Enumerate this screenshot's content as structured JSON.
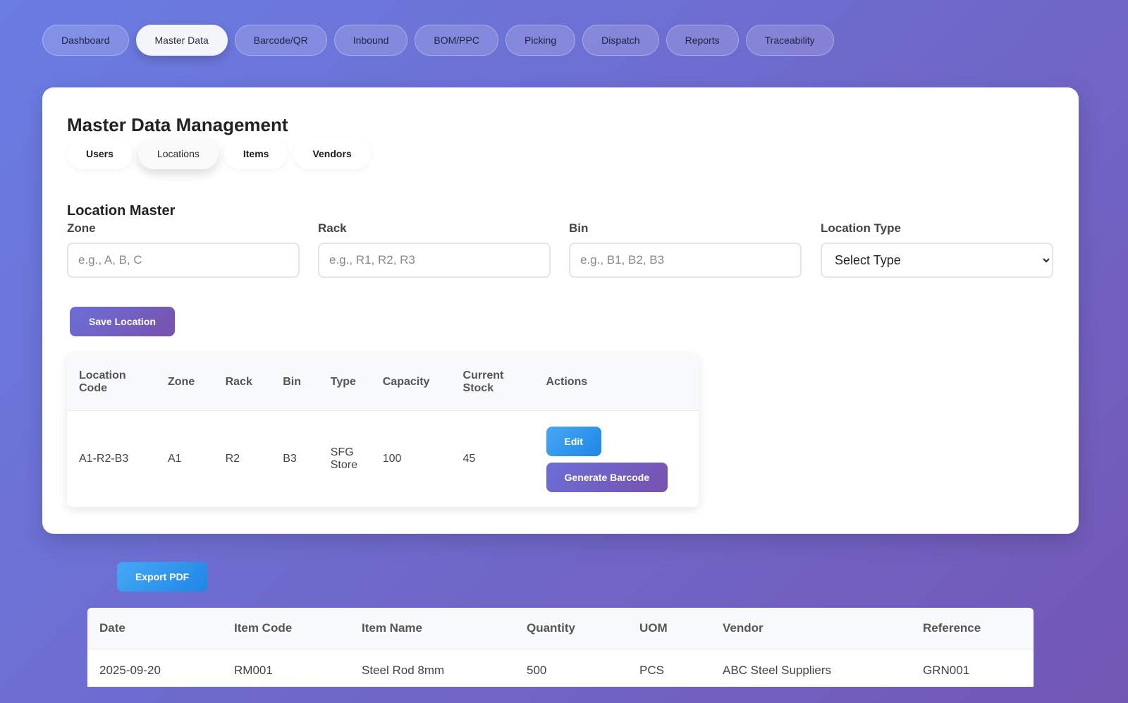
{
  "nav": {
    "tabs": [
      {
        "label": "Dashboard",
        "active": false
      },
      {
        "label": "Master Data",
        "active": true
      },
      {
        "label": "Barcode/QR",
        "active": false
      },
      {
        "label": "Inbound",
        "active": false
      },
      {
        "label": "BOM/PPC",
        "active": false
      },
      {
        "label": "Picking",
        "active": false
      },
      {
        "label": "Dispatch",
        "active": false
      },
      {
        "label": "Reports",
        "active": false
      },
      {
        "label": "Traceability",
        "active": false
      }
    ]
  },
  "master": {
    "title": "Master Data Management",
    "subtabs": [
      {
        "label": "Users",
        "active": false
      },
      {
        "label": "Locations",
        "active": true
      },
      {
        "label": "Items",
        "active": false
      },
      {
        "label": "Vendors",
        "active": false
      }
    ],
    "section_title": "Location Master",
    "form": {
      "zone_label": "Zone",
      "zone_placeholder": "e.g., A, B, C",
      "rack_label": "Rack",
      "rack_placeholder": "e.g., R1, R2, R3",
      "bin_label": "Bin",
      "bin_placeholder": "e.g., B1, B2, B3",
      "type_label": "Location Type",
      "type_selected": "Select Type",
      "save_label": "Save Location"
    },
    "table": {
      "headers": [
        "Location Code",
        "Zone",
        "Rack",
        "Bin",
        "Type",
        "Capacity",
        "Current Stock",
        "Actions"
      ],
      "rows": [
        {
          "code": "A1-R2-B3",
          "zone": "A1",
          "rack": "R2",
          "bin": "B3",
          "type": "SFG Store",
          "capacity": "100",
          "stock": "45"
        }
      ],
      "edit_label": "Edit",
      "barcode_label": "Generate Barcode"
    }
  },
  "report": {
    "export_label": "Export PDF",
    "headers": [
      "Date",
      "Item Code",
      "Item Name",
      "Quantity",
      "UOM",
      "Vendor",
      "Reference"
    ],
    "rows": [
      [
        "2025-09-20",
        "RM001",
        "Steel Rod 8mm",
        "500",
        "PCS",
        "ABC Steel Suppliers",
        "GRN001"
      ]
    ]
  },
  "colors": {
    "bg_start": "#6a7de3",
    "bg_end": "#7357b5",
    "primary_button": "#6b6fd8",
    "info_button": "#1f86e6"
  }
}
